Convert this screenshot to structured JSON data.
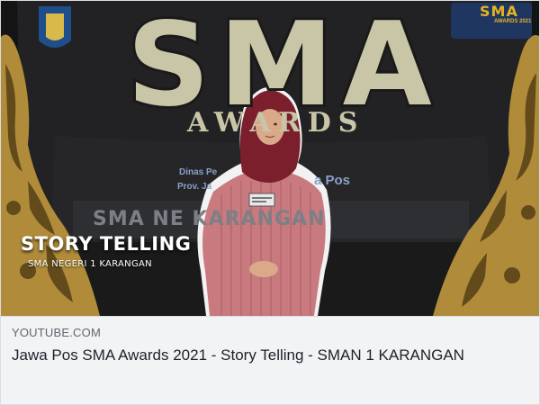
{
  "thumbnail": {
    "sma_word": "SMA",
    "awards_word": "AWARDS",
    "banner_line1": "Dinas Pe",
    "banner_line2": "Prov. Ja",
    "banner_pos": "a Pos",
    "banner_school": "SMA NE           KARANGAN",
    "corner_logo": "SMA",
    "corner_logo_sub": "AWARDS 2021",
    "overlay_title": "STORY TELLING",
    "overlay_subtitle": "SMA NEGERI 1 KARANGAN",
    "colors": {
      "background": "#1b1b1b",
      "logo_cream": "#c9c6a8",
      "gold": "#c7a24a",
      "hijab": "#7a1f2b",
      "dress": "#c97a7f"
    }
  },
  "link_preview": {
    "domain": "YOUTUBE.COM",
    "title": "Jawa Pos SMA Awards 2021 - Story Telling - SMAN 1 KARANGAN"
  }
}
